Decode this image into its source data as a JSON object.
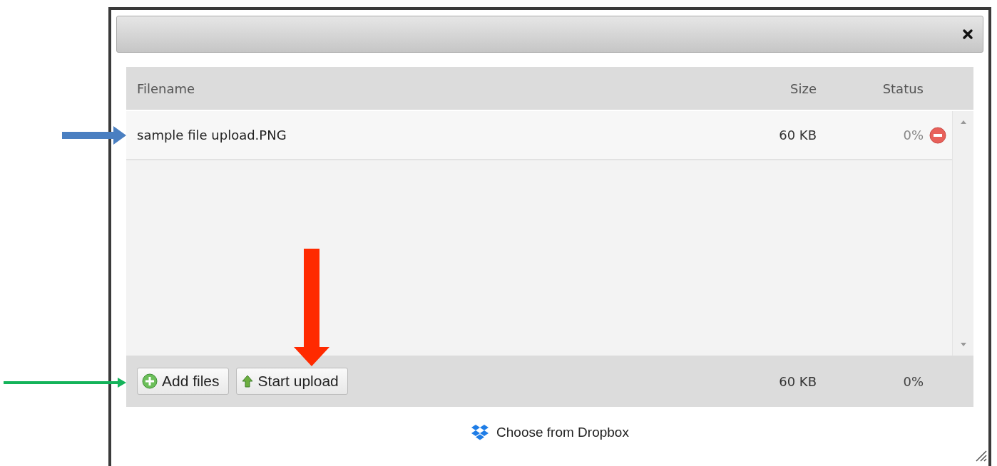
{
  "table": {
    "columns": [
      "Filename",
      "Size",
      "Status"
    ],
    "rows": [
      {
        "filename": "sample file upload.PNG",
        "size": "60 KB",
        "status": "0%"
      }
    ]
  },
  "footer": {
    "buttons": [
      {
        "label": "Add files",
        "kind": "add"
      },
      {
        "label": "Start upload",
        "kind": "upload"
      }
    ],
    "total_size": "60 KB",
    "total_status": "0%"
  },
  "dropbox_link": "Choose from Dropbox"
}
